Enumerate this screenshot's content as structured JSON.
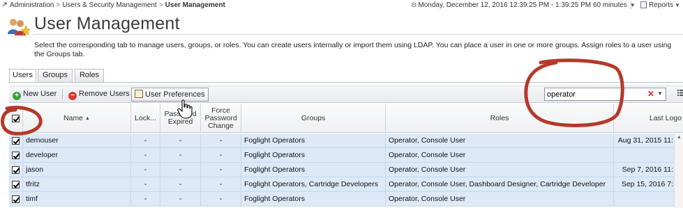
{
  "breadcrumb": {
    "items": [
      "Administration",
      "Users & Security Management"
    ],
    "current": "User Management",
    "separator": ">"
  },
  "time_range": {
    "text": "Monday, December 12, 2016 12:39:25 PM - 1:39:25 PM 60 minutes",
    "icon": "clock-icon"
  },
  "reports": {
    "label": "Reports"
  },
  "page": {
    "title": "User Management",
    "description": "Select the corresponding tab to manage users, groups, or roles. You can create users internally or import them using LDAP. You can place a user in one or more groups. Assign roles to a user using the Groups tab."
  },
  "tabs": [
    {
      "label": "Users",
      "active": true
    },
    {
      "label": "Groups",
      "active": false
    },
    {
      "label": "Roles",
      "active": false
    }
  ],
  "toolbar": {
    "new_user_label": "New User",
    "remove_users_label": "Remove Users",
    "user_preferences_label": "User Preferences"
  },
  "search": {
    "value": "operator"
  },
  "table": {
    "columns": [
      "Name",
      "Lock...",
      "Password Expired",
      "Force Password Change",
      "Groups",
      "Roles",
      "Last Logo"
    ],
    "rows": [
      {
        "name": "demouser",
        "locked": "-",
        "password_expired": "-",
        "force_change": "-",
        "groups": "Foglight Operators",
        "roles": "Operator, Console User",
        "last_login": "Aug 31, 2015 11:"
      },
      {
        "name": "developer",
        "locked": "-",
        "password_expired": "-",
        "force_change": "-",
        "groups": "Foglight Operators",
        "roles": "Operator, Console User",
        "last_login": ""
      },
      {
        "name": "jason",
        "locked": "-",
        "password_expired": "-",
        "force_change": "-",
        "groups": "Foglight Operators",
        "roles": "Operator, Console User",
        "last_login": "Sep 7, 2016 11:"
      },
      {
        "name": "tfritz",
        "locked": "-",
        "password_expired": "-",
        "force_change": "-",
        "groups": "Foglight Operators, Cartridge Developers",
        "roles": "Operator, Console User, Dashboard Designer, Cartridge Developer",
        "last_login": "Sep 15, 2016 7:"
      },
      {
        "name": "timf",
        "locked": "-",
        "password_expired": "-",
        "force_change": "-",
        "groups": "Foglight Operators",
        "roles": "Operator, Console User",
        "last_login": ""
      }
    ]
  },
  "colors": {
    "row_bg": "#dde9f7",
    "annotation": "#b5392a",
    "add_icon": "#3aa33a",
    "remove_icon": "#d63b2f"
  }
}
